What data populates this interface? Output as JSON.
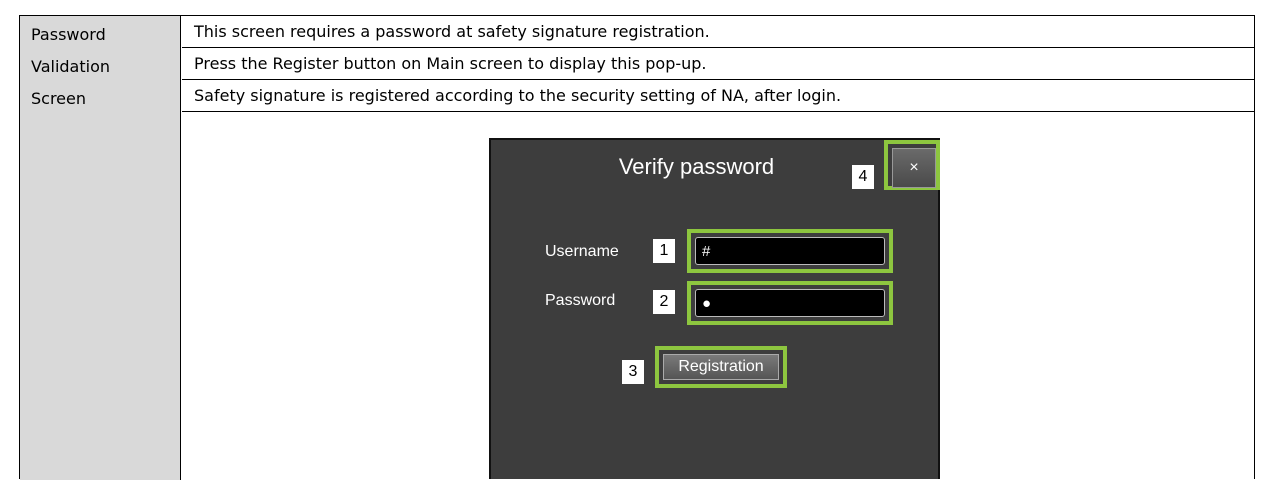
{
  "label": {
    "line1": "Password",
    "line2": "Validation",
    "line3": "Screen"
  },
  "description": [
    "This screen requires a password at safety signature registration.",
    "Press the Register button on Main screen to display this pop-up.",
    "Safety signature is registered according to the security setting of NA, after login."
  ],
  "dialog": {
    "title": "Verify password",
    "close_label": "×",
    "username_label": "Username",
    "username_value": "#",
    "password_label": "Password",
    "password_value": "●",
    "registration_label": "Registration"
  },
  "callouts": {
    "c1": "1",
    "c2": "2",
    "c3": "3",
    "c4": "4"
  },
  "colors": {
    "highlight": "#8dc63f",
    "dialog_bg": "#3d3d3d",
    "label_cell_bg": "#d9d9d9"
  }
}
